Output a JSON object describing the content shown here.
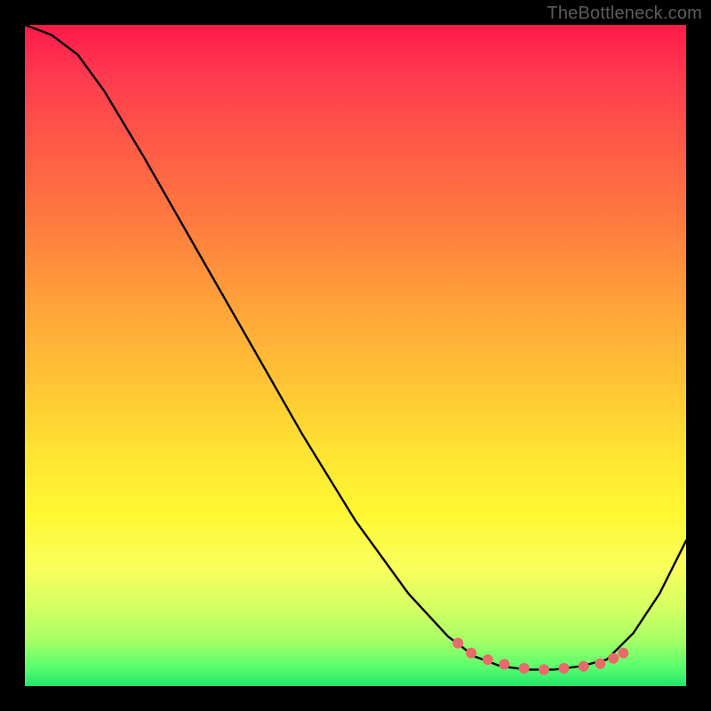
{
  "watermark": "TheBottleneck.com",
  "chart_data": {
    "type": "line",
    "title": "",
    "xlabel": "",
    "ylabel": "",
    "notes": "No axis tick labels are visible in the image; x runs 0–1 across plot width, y is bottleneck % with 0 at bottom edge and 1 at top edge. Curve shows a V-shape with a flat minimum roughly between x≈0.67 and x≈0.88.",
    "xlim": [
      0,
      1
    ],
    "ylim": [
      0,
      1
    ],
    "curve": {
      "name": "bottleneck-curve",
      "color": "#000000",
      "x": [
        0.0,
        0.04,
        0.08,
        0.12,
        0.18,
        0.26,
        0.34,
        0.42,
        0.5,
        0.58,
        0.64,
        0.68,
        0.72,
        0.76,
        0.8,
        0.84,
        0.88,
        0.92,
        0.96,
        1.0
      ],
      "y": [
        1.0,
        0.985,
        0.955,
        0.9,
        0.8,
        0.66,
        0.52,
        0.38,
        0.25,
        0.14,
        0.075,
        0.045,
        0.03,
        0.025,
        0.025,
        0.03,
        0.04,
        0.08,
        0.14,
        0.22
      ]
    },
    "markers": {
      "name": "optimal-range",
      "color": "#e86a6a",
      "radius": 6,
      "x": [
        0.655,
        0.675,
        0.7,
        0.725,
        0.755,
        0.785,
        0.815,
        0.845,
        0.87,
        0.89,
        0.905
      ],
      "y": [
        0.065,
        0.05,
        0.04,
        0.033,
        0.027,
        0.025,
        0.027,
        0.03,
        0.034,
        0.042,
        0.05
      ]
    }
  }
}
